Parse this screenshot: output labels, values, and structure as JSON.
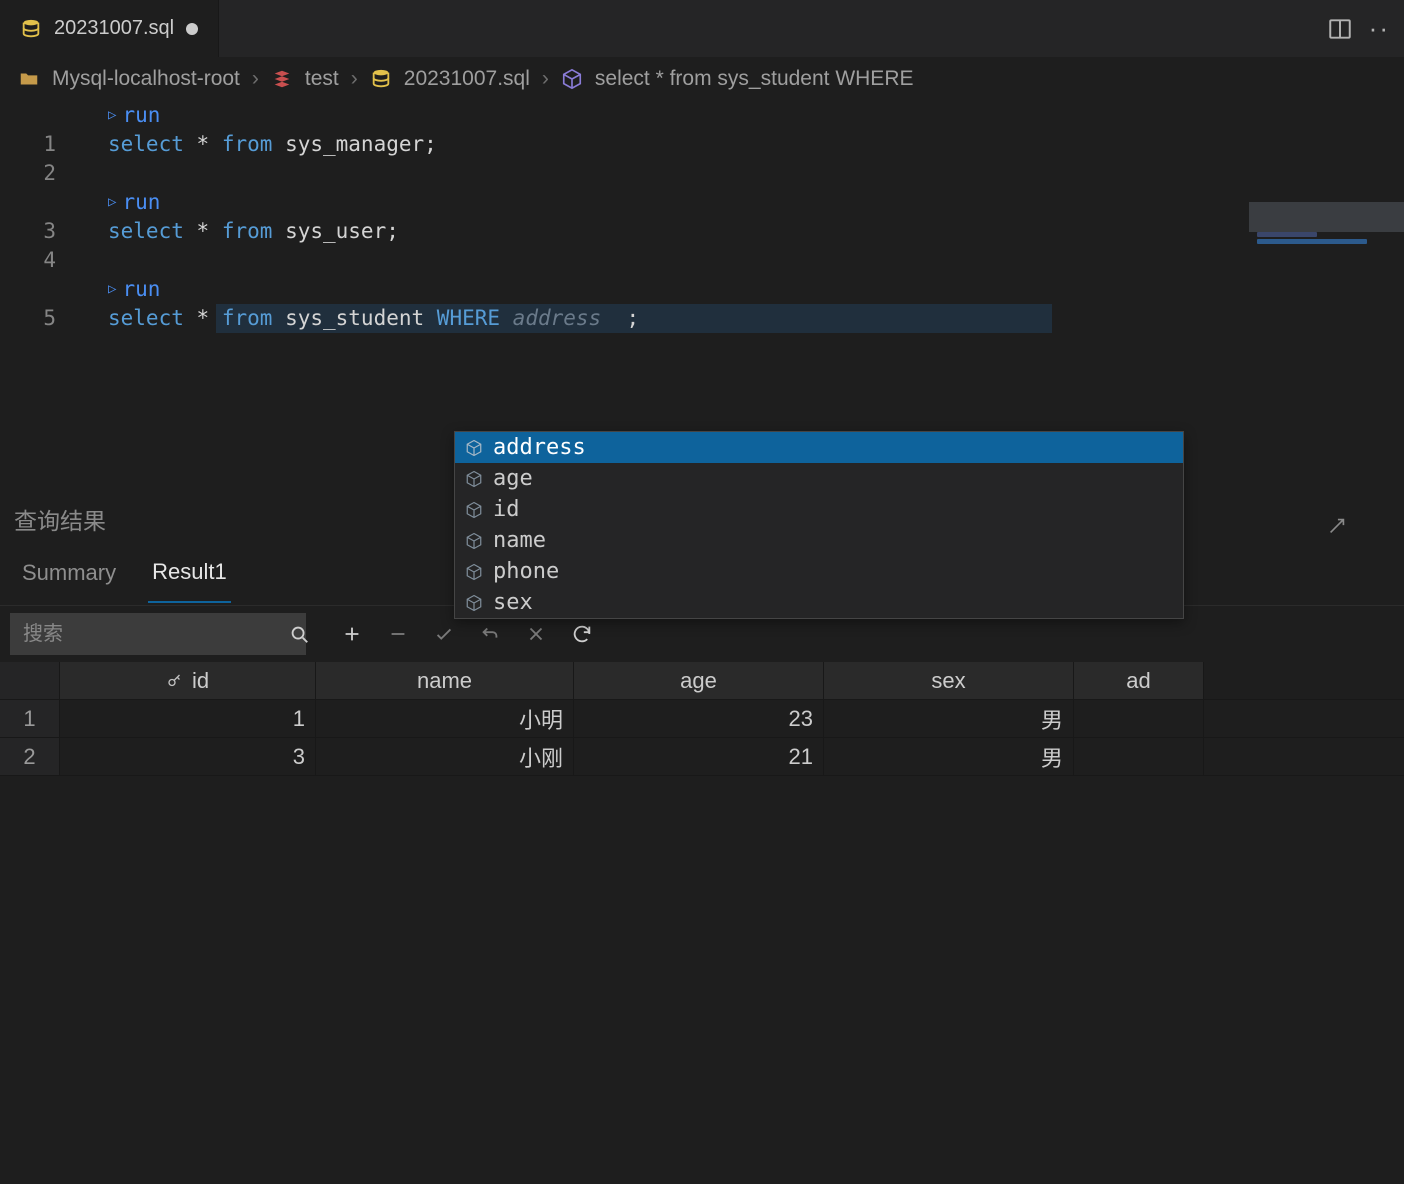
{
  "tab": {
    "filename": "20231007.sql",
    "modified": true
  },
  "breadcrumb": {
    "root": "Mysql-localhost-root",
    "db": "test",
    "file": "20231007.sql",
    "statement": "select * from sys_student WHERE"
  },
  "run_label": "run",
  "code": {
    "line1": {
      "kw1": "select",
      "star": "*",
      "kw2": "from",
      "tbl": "sys_manager;"
    },
    "line3": {
      "kw1": "select",
      "star": "*",
      "kw2": "from",
      "tbl": "sys_user;"
    },
    "line5": {
      "kw1": "select",
      "star": "*",
      "kw2": "from",
      "tbl": "sys_student",
      "kw3": "WHERE",
      "hint": "address",
      "semi": ";"
    }
  },
  "linenos": [
    "1",
    "2",
    "3",
    "4",
    "5"
  ],
  "completions": {
    "selected_index": 0,
    "items": [
      "address",
      "age",
      "id",
      "name",
      "phone",
      "sex"
    ]
  },
  "results": {
    "panel_title": "查询结果",
    "tabs": {
      "summary": "Summary",
      "result1": "Result1",
      "active": "Result1"
    },
    "search_placeholder": "搜索",
    "columns": {
      "id": "id",
      "name": "name",
      "age": "age",
      "sex": "sex",
      "addr_partial": "ad"
    },
    "rows": [
      {
        "rowno": "1",
        "id": "1",
        "name": "小明",
        "age": "23",
        "sex": "男"
      },
      {
        "rowno": "2",
        "id": "3",
        "name": "小刚",
        "age": "21",
        "sex": "男"
      }
    ]
  }
}
